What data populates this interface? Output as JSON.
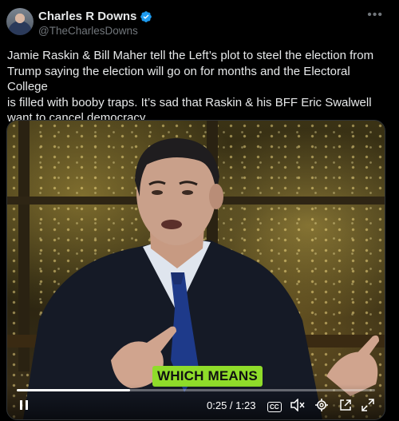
{
  "author": {
    "name": "Charles R Downs",
    "handle": "@TheCharlesDowns",
    "verified_color": "#1d9bf0"
  },
  "menu_icon": "more-horizontal-icon",
  "tweet_text": "Jamie Raskin & Bill Maher tell the Left’s plot to steel the election from\nTrump saying the election will go on for months and the Electoral College\nis filled with booby traps.  It’s sad that Raskin & his BFF Eric Swalwell\nwant to cancel democracy.",
  "video": {
    "caption": "WHICH MEANS",
    "caption_color": "#8fdc2a",
    "time_display": "0:25 / 1:23",
    "progress_fraction": 0.316,
    "cc_label": "CC",
    "icons": [
      "pause-icon",
      "closed-captions-icon",
      "mute-icon",
      "settings-icon",
      "pop-out-icon",
      "fullscreen-icon"
    ]
  }
}
